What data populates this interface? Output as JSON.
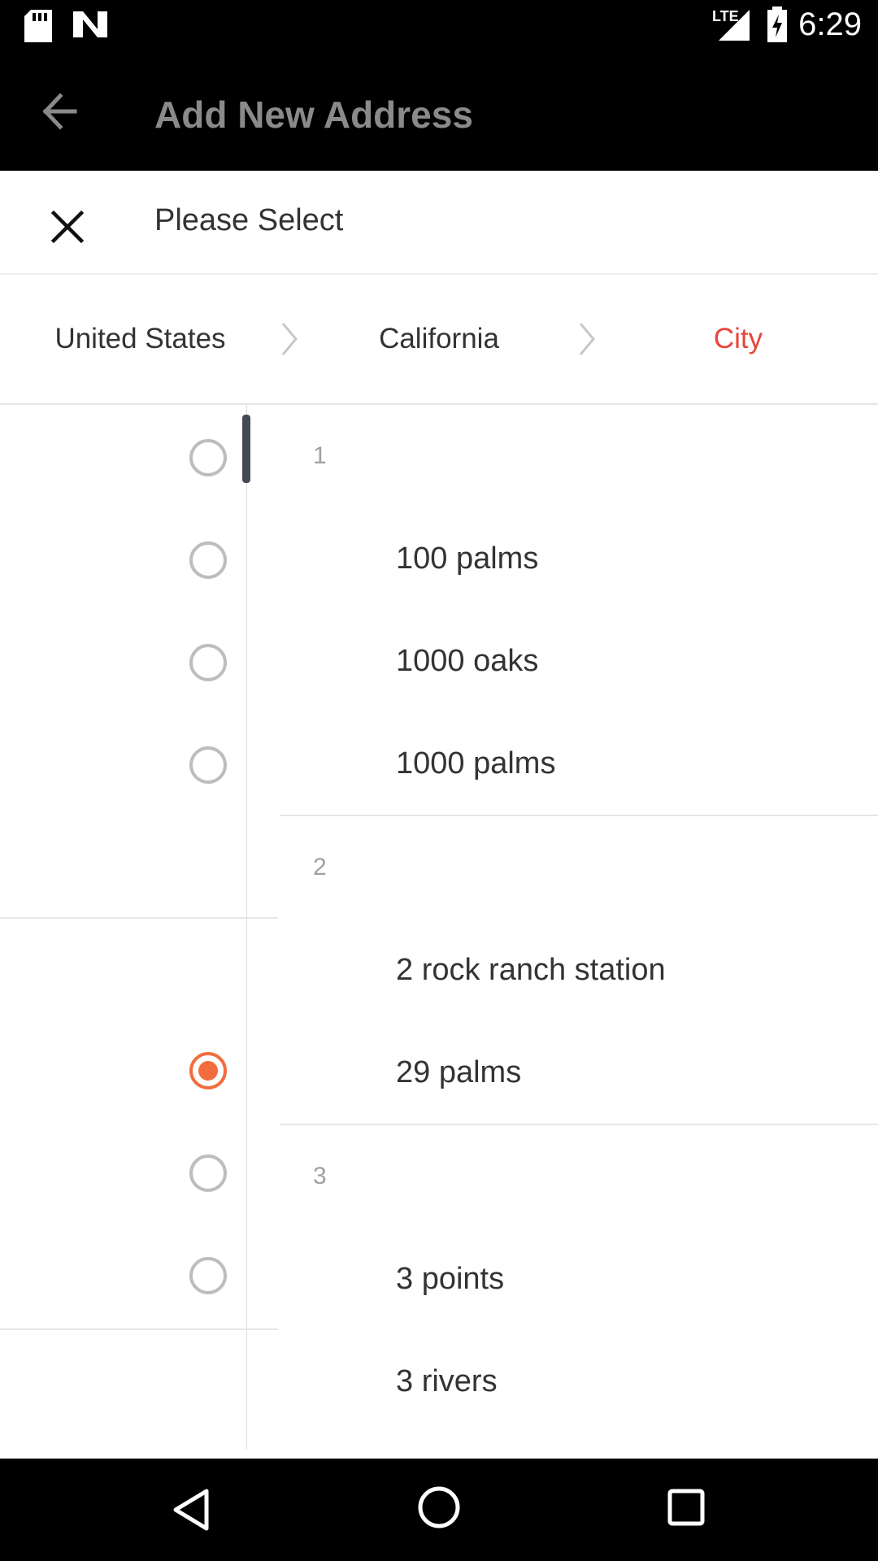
{
  "status_bar": {
    "time": "6:29",
    "network_label": "LTE",
    "icons": [
      "sd-card-icon",
      "n-app-icon",
      "lte-signal-icon",
      "battery-charging-icon"
    ]
  },
  "app_bar": {
    "title": "Add New Address",
    "back_icon": "arrow-left-icon"
  },
  "sheet": {
    "title": "Please Select",
    "close_icon": "close-x-icon"
  },
  "breadcrumb": {
    "country": "United States",
    "state": "California",
    "city": "City",
    "active_color": "#e8453c"
  },
  "list": {
    "groups": [
      {
        "header": "1",
        "items": [
          "100 palms",
          "1000 oaks",
          "1000 palms"
        ]
      },
      {
        "header": "2",
        "items": [
          "2 rock ranch station",
          "29 palms"
        ]
      },
      {
        "header": "3",
        "items": [
          "3 points",
          "3 rivers"
        ]
      }
    ],
    "selected_index": 5,
    "radio_states": [
      false,
      false,
      false,
      false,
      true,
      false,
      false
    ],
    "accent_color": "#f26d3d"
  },
  "nav_bar": {
    "icons": [
      "back-triangle-icon",
      "home-circle-icon",
      "recents-square-icon"
    ]
  }
}
